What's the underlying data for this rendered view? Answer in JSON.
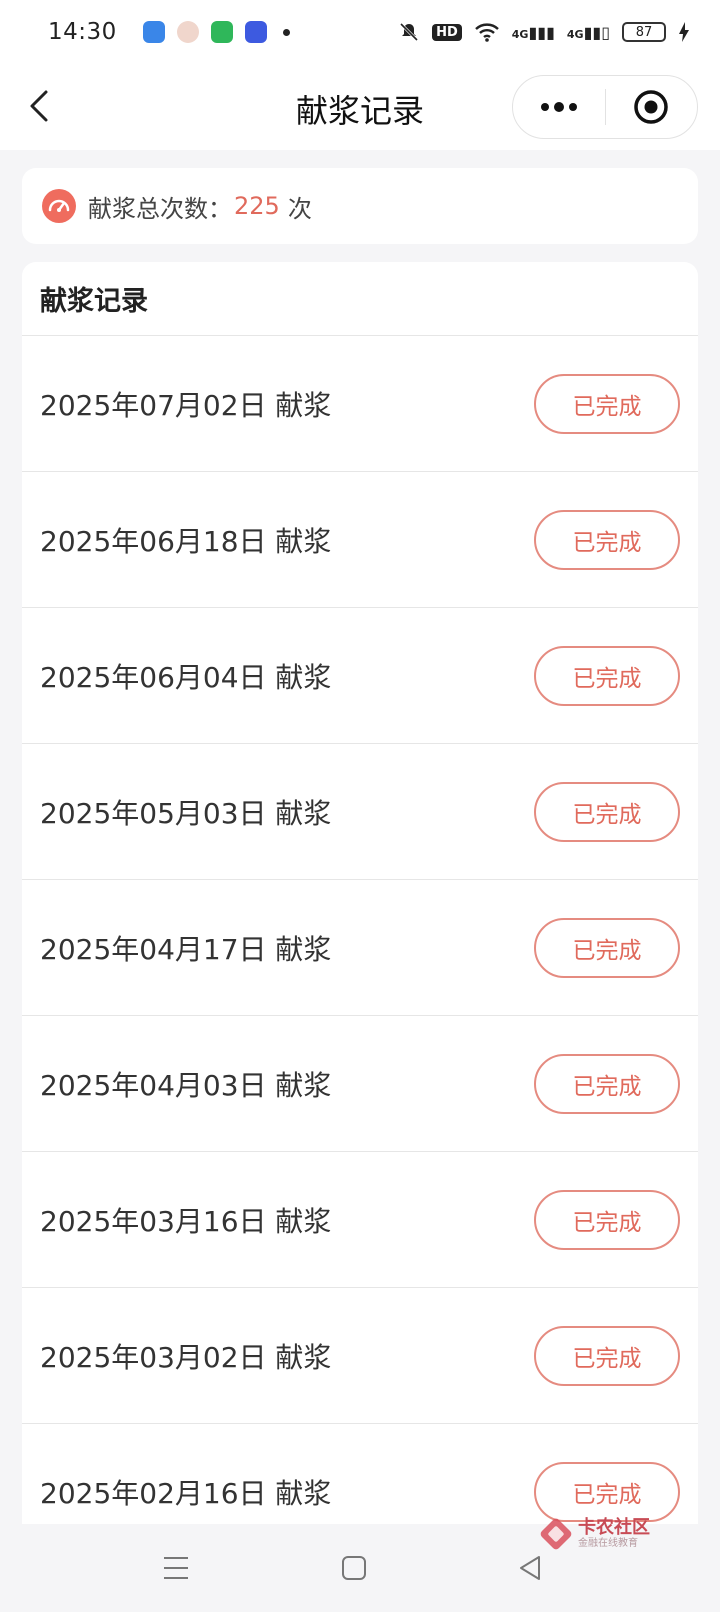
{
  "status_bar": {
    "time": "14:30",
    "hd_label": "HD",
    "network_1": "4G",
    "network_2": "4G",
    "battery": "87"
  },
  "nav": {
    "title": "献浆记录"
  },
  "summary": {
    "label": "献浆总次数：",
    "count": "225",
    "unit": "次"
  },
  "records": {
    "header": "献浆记录",
    "items": [
      {
        "text": "2025年07月02日 献浆",
        "status": "已完成"
      },
      {
        "text": "2025年06月18日 献浆",
        "status": "已完成"
      },
      {
        "text": "2025年06月04日 献浆",
        "status": "已完成"
      },
      {
        "text": "2025年05月03日 献浆",
        "status": "已完成"
      },
      {
        "text": "2025年04月17日 献浆",
        "status": "已完成"
      },
      {
        "text": "2025年04月03日 献浆",
        "status": "已完成"
      },
      {
        "text": "2025年03月16日 献浆",
        "status": "已完成"
      },
      {
        "text": "2025年03月02日 献浆",
        "status": "已完成"
      },
      {
        "text": "2025年02月16日 献浆",
        "status": "已完成"
      }
    ]
  },
  "watermark": {
    "name": "卡农社区",
    "tagline": "金融在线教育"
  },
  "colors": {
    "accent": "#e06a5c",
    "border_accent": "#e58b80",
    "background": "#f5f5f7"
  }
}
